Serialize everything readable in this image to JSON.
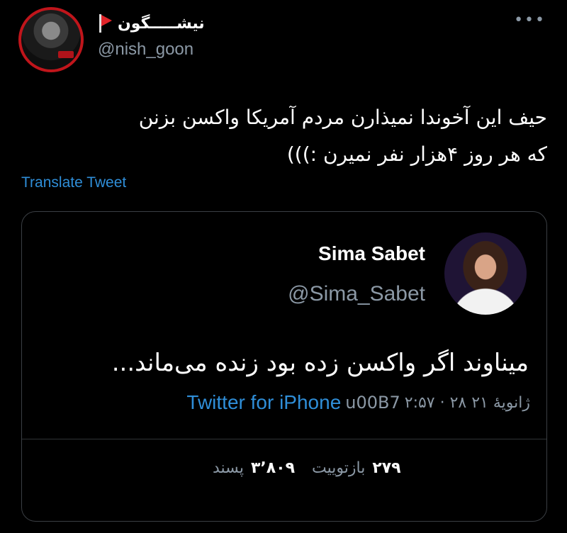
{
  "author": {
    "display_name": "نیشـــــگون",
    "handle": "@nish_goon",
    "more_label": "•••"
  },
  "tweet": {
    "line1": "حیف این آخوندا نمیذارن مردم آمریکا واکسن بزنن",
    "line2": "که هر روز ۴هزار نفر نمیرن :)))",
    "translate_label": "Translate Tweet"
  },
  "quoted": {
    "name": "Sima Sabet",
    "handle": "@Sima_Sabet",
    "text": "میناوند اگر واکسن زده بود زنده می‌ماند...",
    "time": "۲:۵۷ · ۲۸ ژانویهٔ ۲۱",
    "separator": "u00B7",
    "source": "Twitter for iPhone",
    "retweets_count": "۲۷۹",
    "retweets_label": "بازتوییت",
    "likes_count": "۳٬۸۰۹",
    "likes_label": "پسند"
  },
  "colors": {
    "background": "#000000",
    "link": "#2f8ed8",
    "muted": "#8b98a5",
    "avatar_ring": "#c0151b",
    "flag": "#e0242a"
  },
  "icons": [
    "flag-icon",
    "more-icon"
  ]
}
